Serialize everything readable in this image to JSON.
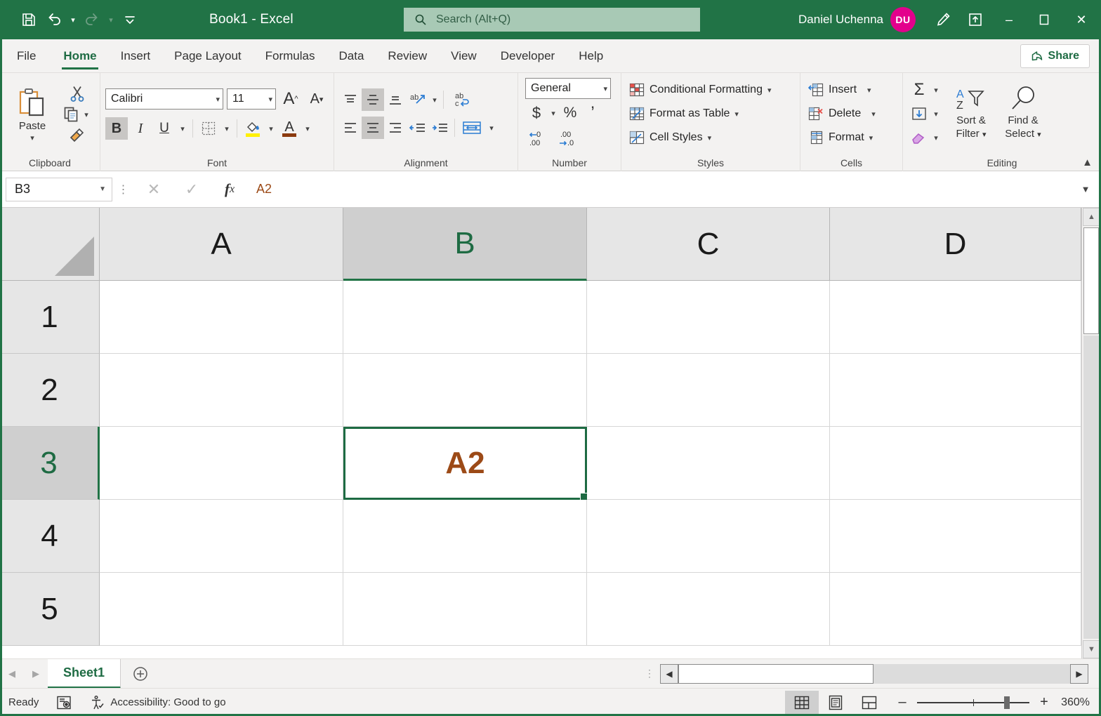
{
  "window": {
    "doc_title": "Book1  -  Excel",
    "minimize_label": "–",
    "restore_label": "❐",
    "close_label": "✕"
  },
  "quick_access": {
    "save": "save-icon",
    "undo": "undo-icon",
    "redo": "redo-icon",
    "customize": "customize-qat-icon"
  },
  "search": {
    "placeholder": "Search (Alt+Q)",
    "value": ""
  },
  "account": {
    "name": "Daniel Uchenna",
    "initials": "DU"
  },
  "tabs": [
    {
      "label": "File",
      "active": false
    },
    {
      "label": "Home",
      "active": true
    },
    {
      "label": "Insert",
      "active": false
    },
    {
      "label": "Page Layout",
      "active": false
    },
    {
      "label": "Formulas",
      "active": false
    },
    {
      "label": "Data",
      "active": false
    },
    {
      "label": "Review",
      "active": false
    },
    {
      "label": "View",
      "active": false
    },
    {
      "label": "Developer",
      "active": false
    },
    {
      "label": "Help",
      "active": false
    }
  ],
  "share": {
    "label": "Share"
  },
  "ribbon": {
    "clipboard": {
      "label": "Clipboard",
      "paste": "Paste",
      "cut": "cut-icon",
      "copy": "copy-icon",
      "format_painter": "format-painter-icon"
    },
    "font": {
      "label": "Font",
      "font_name": "Calibri",
      "font_size": "11",
      "grow_font": "A",
      "shrink_font": "A",
      "bold": "B",
      "italic": "I",
      "underline": "U",
      "borders": "borders-icon",
      "fill_color": "fill-color-icon",
      "font_color": "font-color-icon",
      "bold_active": true,
      "fill_color_value": "#FFF000",
      "font_color_value": "#8B3A0E"
    },
    "alignment": {
      "label": "Alignment",
      "top_align": "top-align-icon",
      "middle_align": "middle-align-icon",
      "bottom_align": "bottom-align-icon",
      "orientation": "orientation-icon",
      "align_left": "align-left-icon",
      "align_center": "align-center-icon",
      "align_right": "align-right-icon",
      "decrease_indent": "decrease-indent-icon",
      "increase_indent": "increase-indent-icon",
      "wrap_text": "wrap-text-icon",
      "merge_center": "merge-and-center-icon"
    },
    "number": {
      "label": "Number",
      "format": "General",
      "accounting": "$",
      "percent": "%",
      "comma": "’",
      "increase_decimal": "increase-decimal-icon",
      "decrease_decimal": "decrease-decimal-icon"
    },
    "styles": {
      "label": "Styles",
      "items": [
        {
          "label": "Conditional Formatting",
          "icon": "conditional-formatting-icon"
        },
        {
          "label": "Format as Table",
          "icon": "format-as-table-icon"
        },
        {
          "label": "Cell Styles",
          "icon": "cell-styles-icon"
        }
      ]
    },
    "cells": {
      "label": "Cells",
      "items": [
        {
          "label": "Insert",
          "icon": "insert-cells-icon"
        },
        {
          "label": "Delete",
          "icon": "delete-cells-icon"
        },
        {
          "label": "Format",
          "icon": "format-cells-icon"
        }
      ]
    },
    "editing": {
      "label": "Editing",
      "autosum": "Σ",
      "fill": "fill-down-icon",
      "clear": "clear-icon",
      "sort_filter_line1": "Sort &",
      "sort_filter_line2": "Filter",
      "find_select_line1": "Find &",
      "find_select_line2": "Select"
    },
    "collapse": "collapse-ribbon-icon"
  },
  "formula_bar": {
    "name_box": "B3",
    "cancel": "✕",
    "enter": "✓",
    "insert_function": "fx",
    "value": "A2"
  },
  "grid": {
    "columns": [
      "A",
      "B",
      "C",
      "D"
    ],
    "selected_column": "B",
    "rows": [
      "1",
      "2",
      "3",
      "4",
      "5"
    ],
    "selected_row": "3",
    "active_cell": "B3",
    "cells": {
      "B3": "A2"
    },
    "accent_color": "#217346",
    "cell_text_color": "#9C4A17"
  },
  "sheet_tabs": {
    "prev": "◀",
    "next": "▶",
    "sheets": [
      {
        "label": "Sheet1",
        "active": true
      }
    ],
    "add_sheet": "add-sheet-icon"
  },
  "status_bar": {
    "mode": "Ready",
    "macro_icon": "record-macro-icon",
    "accessibility": "Accessibility: Good to go",
    "views": [
      {
        "name": "normal-view",
        "active": true
      },
      {
        "name": "page-layout-view",
        "active": false
      },
      {
        "name": "page-break-preview",
        "active": false
      }
    ],
    "zoom_out": "–",
    "zoom_in": "+",
    "zoom_level": "360%"
  }
}
